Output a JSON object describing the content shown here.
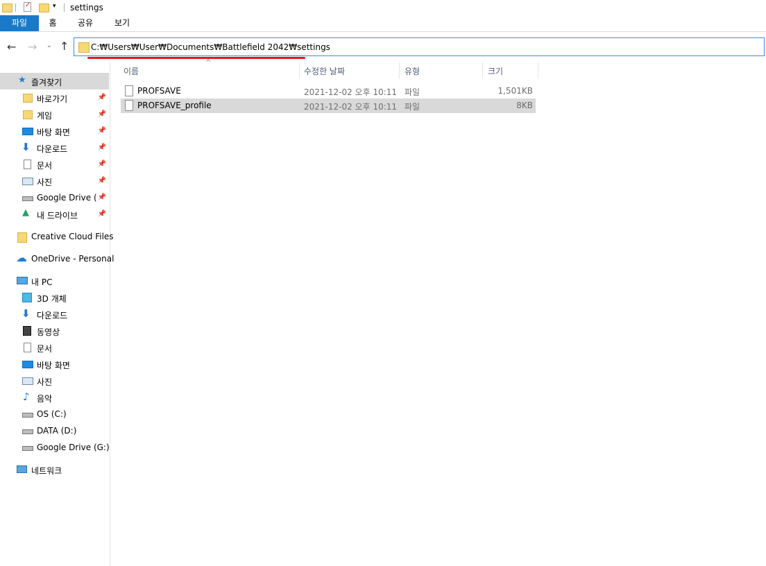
{
  "window": {
    "title": "settings"
  },
  "ribbon": {
    "tabs": [
      "파일",
      "홈",
      "공유",
      "보기"
    ]
  },
  "address": {
    "path": "C:₩Users₩User₩Documents₩Battlefield 2042₩settings"
  },
  "nav": {
    "quick_access": "즐겨찾기",
    "pinned": [
      {
        "label": "바로가기",
        "icon": "folder-icon"
      },
      {
        "label": "게임",
        "icon": "folder-icon"
      },
      {
        "label": "바탕 화면",
        "icon": "desktop-icon"
      },
      {
        "label": "다운로드",
        "icon": "download-icon"
      },
      {
        "label": "문서",
        "icon": "document-icon"
      },
      {
        "label": "사진",
        "icon": "picture-icon"
      },
      {
        "label": "Google Drive (G",
        "icon": "drive-icon"
      },
      {
        "label": "내 드라이브",
        "icon": "google-drive-icon"
      }
    ],
    "creative_cloud": "Creative Cloud Files",
    "onedrive": "OneDrive - Personal",
    "this_pc": "내 PC",
    "pc_items": [
      {
        "label": "3D 개체",
        "icon": "3d-objects-icon"
      },
      {
        "label": "다운로드",
        "icon": "download-icon"
      },
      {
        "label": "동영상",
        "icon": "video-icon"
      },
      {
        "label": "문서",
        "icon": "document-icon"
      },
      {
        "label": "바탕 화면",
        "icon": "desktop-icon"
      },
      {
        "label": "사진",
        "icon": "picture-icon"
      },
      {
        "label": "음악",
        "icon": "music-icon"
      },
      {
        "label": "OS (C:)",
        "icon": "drive-icon"
      },
      {
        "label": "DATA (D:)",
        "icon": "drive-icon"
      },
      {
        "label": "Google Drive (G:)",
        "icon": "drive-icon"
      }
    ],
    "network": "네트워크"
  },
  "columns": {
    "name": "이름",
    "modified": "수정한 날짜",
    "type": "유형",
    "size": "크기"
  },
  "files": [
    {
      "name": "PROFSAVE",
      "modified": "2021-12-02 오후 10:11",
      "type": "파일",
      "size": "1,501KB"
    },
    {
      "name": "PROFSAVE_profile",
      "modified": "2021-12-02 오후 10:11",
      "type": "파일",
      "size": "8KB"
    }
  ],
  "colors": {
    "accent": "#1979ca",
    "underline": "#e21b1b",
    "selected_row": "#d9d9d9"
  }
}
